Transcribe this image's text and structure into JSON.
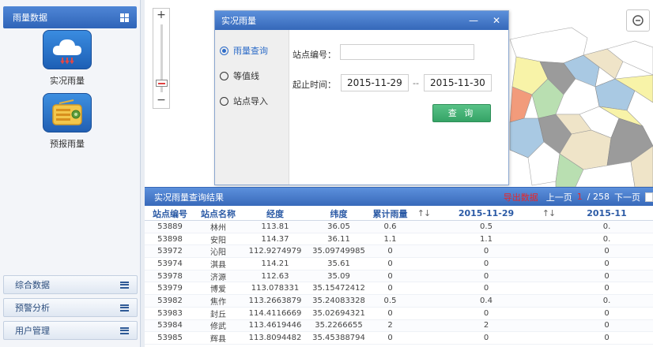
{
  "sidebar": {
    "header": "雨量数据",
    "apps": [
      {
        "label": "实况雨量",
        "icon": "cloud-rain-icon"
      },
      {
        "label": "预报雨量",
        "icon": "radio-icon"
      }
    ],
    "accordion": [
      {
        "label": "综合数据"
      },
      {
        "label": "预警分析"
      },
      {
        "label": "用户管理"
      }
    ]
  },
  "map": {
    "zoom_in": "+",
    "zoom_out": "−",
    "colors": {
      "yellow": "#f8f3a8",
      "gray": "#9b9b9b",
      "orange": "#f29b7b",
      "blue": "#a9c9e3",
      "green": "#b9dfb1",
      "beige": "#efe4c8"
    }
  },
  "dialog": {
    "title": "实况雨量",
    "minimize": "—",
    "close": "✕",
    "options": [
      {
        "label": "雨量查询",
        "selected": true
      },
      {
        "label": "等值线",
        "selected": false
      },
      {
        "label": "站点导入",
        "selected": false
      }
    ],
    "station_label": "站点编号：",
    "station_value": "",
    "time_label": "起止时间：",
    "start_date": "2015-11-29",
    "separator": "--",
    "end_date": "2015-11-30",
    "query_button": "查 询"
  },
  "results": {
    "title": "实况雨量查询结果",
    "export": "导出数据",
    "prev": "上一页",
    "page": "1",
    "total": "/ 258",
    "next": "下一页",
    "columns": [
      "站点编号",
      "站点名称",
      "经度",
      "纬度",
      "累计雨量",
      "↑↓",
      "2015-11-29",
      "↑↓",
      "2015-11"
    ],
    "rows": [
      [
        "53889",
        "林州",
        "113.81",
        "36.05",
        "0.6",
        "",
        "0.5",
        "",
        "0."
      ],
      [
        "53898",
        "安阳",
        "114.37",
        "36.11",
        "1.1",
        "",
        "1.1",
        "",
        "0."
      ],
      [
        "53972",
        "沁阳",
        "112.9274979",
        "35.09749985",
        "0",
        "",
        "0",
        "",
        "0"
      ],
      [
        "53974",
        "淇县",
        "114.21",
        "35.61",
        "0",
        "",
        "0",
        "",
        "0"
      ],
      [
        "53978",
        "济源",
        "112.63",
        "35.09",
        "0",
        "",
        "0",
        "",
        "0"
      ],
      [
        "53979",
        "博爱",
        "113.078331",
        "35.15472412",
        "0",
        "",
        "0",
        "",
        "0"
      ],
      [
        "53982",
        "焦作",
        "113.2663879",
        "35.24083328",
        "0.5",
        "",
        "0.4",
        "",
        "0."
      ],
      [
        "53983",
        "封丘",
        "114.4116669",
        "35.02694321",
        "0",
        "",
        "0",
        "",
        "0"
      ],
      [
        "53984",
        "修武",
        "113.4619446",
        "35.2266655",
        "2",
        "",
        "2",
        "",
        "0"
      ],
      [
        "53985",
        "辉县",
        "113.8094482",
        "35.45388794",
        "0",
        "",
        "0",
        "",
        "0"
      ]
    ]
  }
}
